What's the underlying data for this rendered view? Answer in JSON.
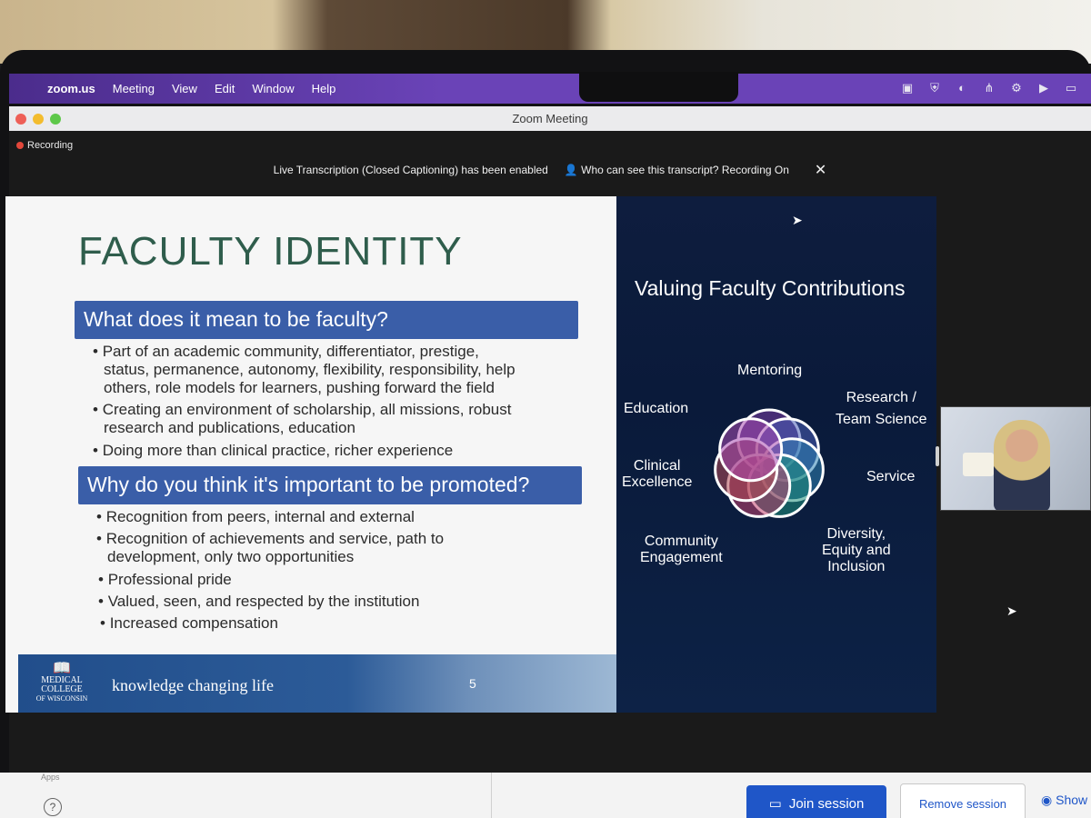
{
  "menubar": {
    "app_name": "zoom.us",
    "items": [
      "Meeting",
      "View",
      "Edit",
      "Window",
      "Help"
    ]
  },
  "window": {
    "title": "Zoom Meeting"
  },
  "meeting": {
    "recording_label": "Recording",
    "banner_text": "Live Transcription (Closed Captioning) has been enabled",
    "banner_link": "Who can see this transcript? Recording On",
    "banner_close": "✕"
  },
  "slide": {
    "title": "FACULTY IDENTITY",
    "q1": "What does it mean to be faculty?",
    "q1_bullets": [
      "Part of an academic community, differentiator, prestige,",
      "status, permanence, autonomy, flexibility, responsibility, help",
      "others, role models for learners, pushing forward the field",
      "Creating an environment of scholarship, all missions, robust",
      "research and publications, education",
      "Doing more than clinical practice, richer experience"
    ],
    "q2": "Why do you think it's important to be promoted?",
    "q2_bullets": [
      "Recognition from peers, internal and external",
      "Recognition of achievements and service, path to",
      "development, only two opportunities",
      "Professional pride",
      "Valued, seen, and respected by the institution",
      "Increased compensation"
    ],
    "logo_lines": [
      "MEDICAL",
      "COLLEGE",
      "OF WISCONSIN"
    ],
    "tagline": "knowledge changing life",
    "page_number": "5",
    "right_title": "Valuing Faculty Contributions",
    "labels": {
      "mentoring": "Mentoring",
      "research": [
        "Research /",
        "Team Science"
      ],
      "education": "Education",
      "clinical": [
        "Clinical",
        "Excellence"
      ],
      "service": "Service",
      "community": [
        "Community",
        "Engagement"
      ],
      "diversity": [
        "Diversity,",
        "Equity and",
        "Inclusion"
      ]
    },
    "circle_colors": [
      "#7b3ea6",
      "#4b5fb8",
      "#2f83b4",
      "#1f8f7b",
      "#c2416e",
      "#b24a55",
      "#a84bb0"
    ]
  },
  "bottom": {
    "apps_label": "Apps",
    "join_label": "Join session",
    "remove_label": "Remove session",
    "show_label": "Show"
  }
}
